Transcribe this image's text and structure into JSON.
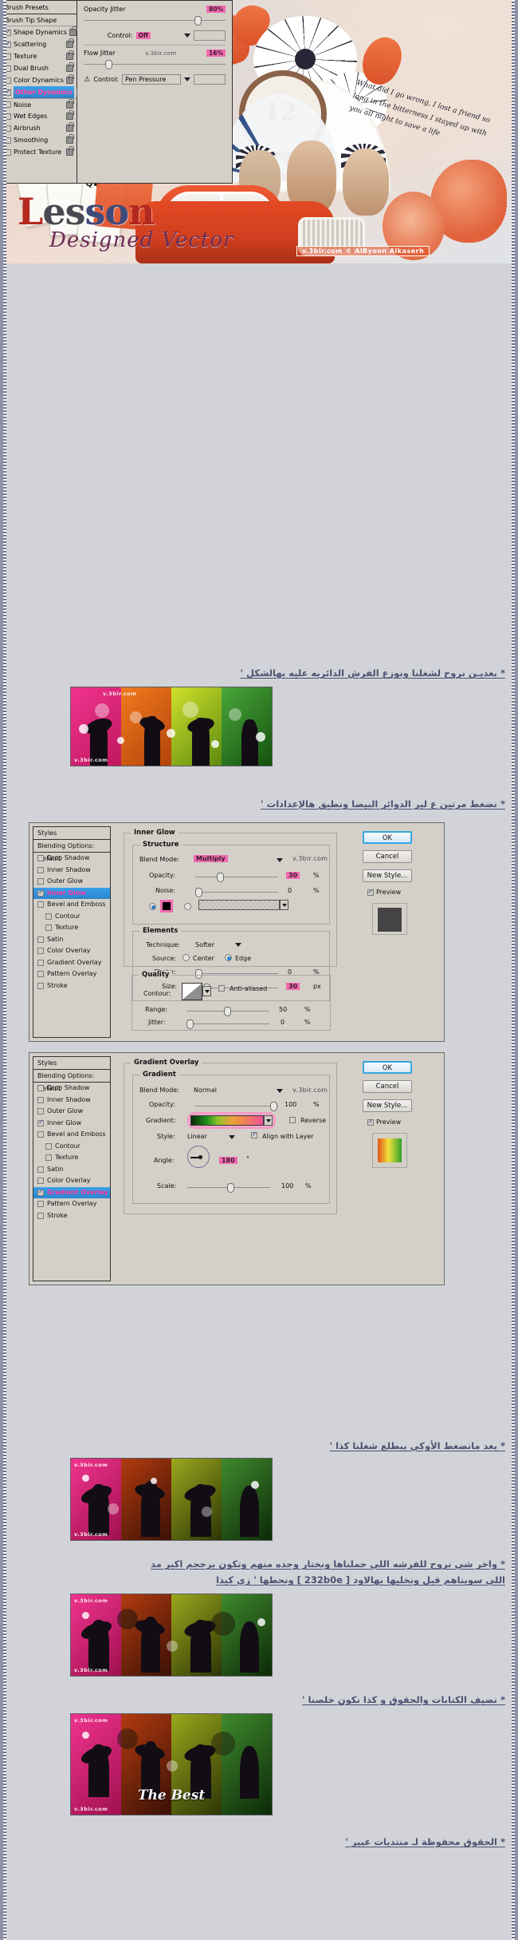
{
  "header": {
    "title_main": "Lesson",
    "title_sub": "Designed Vector",
    "clock_number": "12",
    "handwriting": "What did I go wrong, I lost a friend  so long in the bitterness  I stayed up with you all night  to save a life",
    "watermark": "v.3bir.com © AlByoon Alkaserh"
  },
  "brush_panel": {
    "left_header": "Brush Presets",
    "left_subheader": "Brush Tip Shape",
    "options": [
      {
        "label": "Shape Dynamics",
        "checked": true,
        "highlight": false,
        "locked": true
      },
      {
        "label": "Scattering",
        "checked": true,
        "highlight": false,
        "locked": true
      },
      {
        "label": "Texture",
        "checked": false,
        "highlight": false,
        "locked": true
      },
      {
        "label": "Dual Brush",
        "checked": false,
        "highlight": false,
        "locked": true
      },
      {
        "label": "Color Dynamics",
        "checked": false,
        "highlight": false,
        "locked": true
      },
      {
        "label": "Other Dynamics",
        "checked": true,
        "highlight": true,
        "locked": true
      },
      {
        "label": "Noise",
        "checked": false,
        "highlight": false,
        "locked": true
      },
      {
        "label": "Wet Edges",
        "checked": false,
        "highlight": false,
        "locked": true
      },
      {
        "label": "Airbrush",
        "checked": false,
        "highlight": false,
        "locked": true
      },
      {
        "label": "Smoothing",
        "checked": false,
        "highlight": false,
        "locked": true
      },
      {
        "label": "Protect Texture",
        "checked": false,
        "highlight": false,
        "locked": true
      }
    ],
    "opacity_jitter_label": "Opacity Jitter",
    "opacity_jitter_value": "80%",
    "opacity_control_label": "Control:",
    "opacity_control_value": "Off",
    "flow_jitter_label": "Flow Jitter",
    "flow_jitter_value": "16%",
    "flow_control_label": "Control:",
    "flow_control_value": "Pen Pressure",
    "watermark": "v.3bir.com"
  },
  "caption_1": "* بعديـن نروح لشغلنا ونوزع الفرش الدائريه عليه بهالشكل '",
  "caption_2": "* نضغط مرتين ع لير الدوائر البيضا ونطبق هالإعدادات '",
  "caption_3": "* بعد مانضغط الأوكي يبطلع شغلنا كذا '",
  "caption_4a": "* واخر شي نروح للفرشه اللي حملناها ونختار وحده منهم وتكون برحجم اكبر مد",
  "caption_4b": "اللي سويناهم قبل ونخليها بهالاود [ 232b0e ] ونحطها ' زي كيذا",
  "caption_5": "* نضيف الكتابات والحقوق و كذا نكون خلصنا '",
  "footer": "* الحقوق محفوظة لـ منتديات عبير '",
  "dialog_inner_glow": {
    "styles_header": "Styles",
    "styles_sub": "Blending Options: Default",
    "styles": [
      {
        "label": "Drop Shadow",
        "checked": false,
        "highlight": false,
        "indent": false
      },
      {
        "label": "Inner Shadow",
        "checked": false,
        "highlight": false,
        "indent": false
      },
      {
        "label": "Outer Glow",
        "checked": false,
        "highlight": false,
        "indent": false
      },
      {
        "label": "Inner Glow",
        "checked": true,
        "highlight": true,
        "indent": false
      },
      {
        "label": "Bevel and Emboss",
        "checked": false,
        "highlight": false,
        "indent": false
      },
      {
        "label": "Contour",
        "checked": false,
        "highlight": false,
        "indent": true
      },
      {
        "label": "Texture",
        "checked": false,
        "highlight": false,
        "indent": true
      },
      {
        "label": "Satin",
        "checked": false,
        "highlight": false,
        "indent": false
      },
      {
        "label": "Color Overlay",
        "checked": false,
        "highlight": false,
        "indent": false
      },
      {
        "label": "Gradient Overlay",
        "checked": false,
        "highlight": false,
        "indent": false
      },
      {
        "label": "Pattern Overlay",
        "checked": false,
        "highlight": false,
        "indent": false
      },
      {
        "label": "Stroke",
        "checked": false,
        "highlight": false,
        "indent": false
      }
    ],
    "section_title": "Inner Glow",
    "structure_title": "Structure",
    "blend_mode_label": "Blend Mode:",
    "blend_mode_value": "Multiply",
    "opacity_label": "Opacity:",
    "opacity_value": "30",
    "opacity_unit": "%",
    "noise_label": "Noise:",
    "noise_value": "0",
    "noise_unit": "%",
    "elements_title": "Elements",
    "technique_label": "Technique:",
    "technique_value": "Softer",
    "source_label": "Source:",
    "source_center": "Center",
    "source_edge": "Edge",
    "choke_label": "Choke:",
    "choke_value": "0",
    "choke_unit": "%",
    "size_label": "Size:",
    "size_value": "30",
    "size_unit": "px",
    "quality_title": "Quality",
    "contour_label": "Contour:",
    "antialiased_label": "Anti-aliased",
    "range_label": "Range:",
    "range_value": "50",
    "range_unit": "%",
    "jitter_label": "Jitter:",
    "jitter_value": "0",
    "jitter_unit": "%",
    "watermark": "v.3bir.com",
    "buttons": {
      "ok": "OK",
      "cancel": "Cancel",
      "new_style": "New Style...",
      "preview": "Preview"
    }
  },
  "dialog_gradient_overlay": {
    "styles_header": "Styles",
    "styles_sub": "Blending Options: Default",
    "styles": [
      {
        "label": "Drop Shadow",
        "checked": false,
        "highlight": false,
        "indent": false
      },
      {
        "label": "Inner Shadow",
        "checked": false,
        "highlight": false,
        "indent": false
      },
      {
        "label": "Outer Glow",
        "checked": false,
        "highlight": false,
        "indent": false
      },
      {
        "label": "Inner Glow",
        "checked": true,
        "highlight": false,
        "indent": false
      },
      {
        "label": "Bevel and Emboss",
        "checked": false,
        "highlight": false,
        "indent": false
      },
      {
        "label": "Contour",
        "checked": false,
        "highlight": false,
        "indent": true
      },
      {
        "label": "Texture",
        "checked": false,
        "highlight": false,
        "indent": true
      },
      {
        "label": "Satin",
        "checked": false,
        "highlight": false,
        "indent": false
      },
      {
        "label": "Color Overlay",
        "checked": false,
        "highlight": false,
        "indent": false
      },
      {
        "label": "Gradient Overlay",
        "checked": true,
        "highlight": true,
        "indent": false
      },
      {
        "label": "Pattern Overlay",
        "checked": false,
        "highlight": false,
        "indent": false
      },
      {
        "label": "Stroke",
        "checked": false,
        "highlight": false,
        "indent": false
      }
    ],
    "section_title": "Gradient Overlay",
    "gradient_title": "Gradient",
    "blend_mode_label": "Blend Mode:",
    "blend_mode_value": "Normal",
    "opacity_label": "Opacity:",
    "opacity_value": "100",
    "opacity_unit": "%",
    "gradient_label": "Gradient:",
    "reverse_label": "Reverse",
    "style_label": "Style:",
    "style_value": "Linear",
    "align_label": "Align with Layer",
    "angle_label": "Angle:",
    "angle_value": "180",
    "angle_unit": "°",
    "scale_label": "Scale:",
    "scale_value": "100",
    "scale_unit": "%",
    "watermark": "v.3bir.com",
    "buttons": {
      "ok": "OK",
      "cancel": "Cancel",
      "new_style": "New Style...",
      "preview": "Preview"
    }
  },
  "strips": {
    "wm": "v.3bir.com",
    "best_text": "The Best"
  },
  "colors": {
    "pink_highlight": "#f06ab0",
    "blue_select": "#2f8ccd",
    "magenta_text": "#ff2e9a",
    "panel_bg": "#d4d0c8",
    "page_bg": "#d2d3d8",
    "caption": "#4b5272",
    "gradient_hex": "232b0e"
  }
}
